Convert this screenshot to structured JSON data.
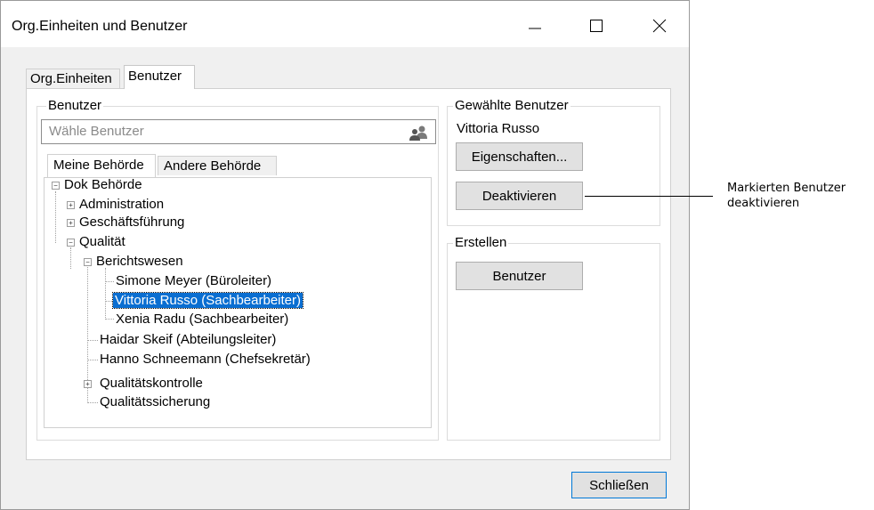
{
  "window": {
    "title": "Org.Einheiten und Benutzer"
  },
  "tabs": [
    {
      "label": "Org.Einheiten",
      "active": false
    },
    {
      "label": "Benutzer",
      "active": true
    }
  ],
  "benutzer": {
    "legend": "Benutzer",
    "search_placeholder": "Wähle Benutzer",
    "inner_tabs": [
      {
        "label": "Meine Behörde",
        "active": true
      },
      {
        "label": "Andere Behörde",
        "active": false
      }
    ],
    "tree": [
      {
        "label": "Dok Behörde",
        "expander": "−"
      },
      {
        "label": "Administration",
        "expander": "+"
      },
      {
        "label": "Geschäftsführung",
        "expander": "+"
      },
      {
        "label": "Qualität",
        "expander": "−"
      },
      {
        "label": "Berichtswesen",
        "expander": "−"
      },
      {
        "label": "Simone Meyer (Büroleiter)"
      },
      {
        "label": "Vittoria Russo (Sachbearbeiter)",
        "selected": true
      },
      {
        "label": "Xenia Radu (Sachbearbeiter)"
      },
      {
        "label": "Haidar Skeif (Abteilungsleiter)"
      },
      {
        "label": "Hanno Schneemann (Chefsekretär)"
      },
      {
        "label": "Qualitätskontrolle",
        "expander": "+"
      },
      {
        "label": "Qualitätssicherung"
      }
    ]
  },
  "selected_users": {
    "legend": "Gewählte Benutzer",
    "name": "Vittoria Russo",
    "properties_button": "Eigenschaften...",
    "deactivate_button": "Deaktivieren"
  },
  "create": {
    "legend": "Erstellen",
    "user_button": "Benutzer"
  },
  "footer": {
    "close_button": "Schließen"
  },
  "annotation": {
    "line1": "Markierten Benutzer",
    "line2": "deaktivieren"
  },
  "colors": {
    "selection": "#0a6ed1",
    "window_bg": "#f0f0f0",
    "focus_border": "#0078d7"
  }
}
